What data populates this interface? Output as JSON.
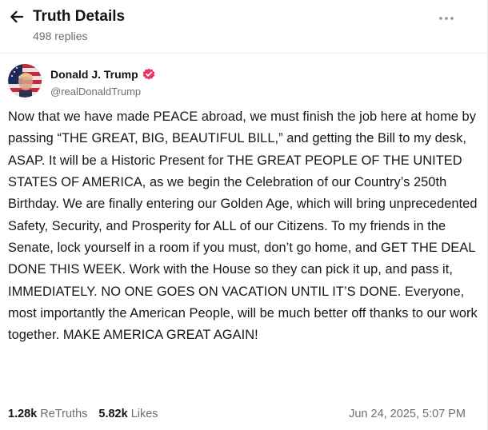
{
  "header": {
    "title": "Truth Details",
    "subtitle": "498 replies"
  },
  "author": {
    "name": "Donald J. Trump",
    "handle": "@realDonaldTrump",
    "verified": true
  },
  "post": {
    "text": "Now that we have made PEACE abroad, we must finish the job here at home by passing “THE GREAT, BIG, BEAUTIFUL BILL,” and getting the Bill to my desk, ASAP. It will be a Historic Present for THE GREAT PEOPLE OF THE UNITED STATES OF AMERICA, as we begin the Celebration of our Country’s 250th Birthday. We are finally entering our Golden Age, which will bring unprecedented Safety, Security, and Prosperity for ALL of our Citizens. To my friends in the Senate, lock yourself in a room if you must, don’t go home, and GET THE DEAL DONE THIS WEEK. Work with the House so they can pick it up, and pass it, IMMEDIATELY. NO ONE GOES ON VACATION UNTIL IT’S DONE. Everyone, most importantly the American People, will be much better off thanks to our work together. MAKE AMERICA GREAT AGAIN!"
  },
  "stats": {
    "retruths_count": "1.28k",
    "retruths_label": "ReTruths",
    "likes_count": "5.82k",
    "likes_label": "Likes",
    "timestamp": "Jun 24, 2025, 5:07 PM"
  },
  "icons": {
    "back": "arrow-left-icon",
    "more": "more-horizontal-icon",
    "verified": "verified-badge-icon"
  },
  "colors": {
    "verified_badge": "#e8355f",
    "text_primary": "#16171c",
    "text_secondary": "#6b6d78"
  }
}
